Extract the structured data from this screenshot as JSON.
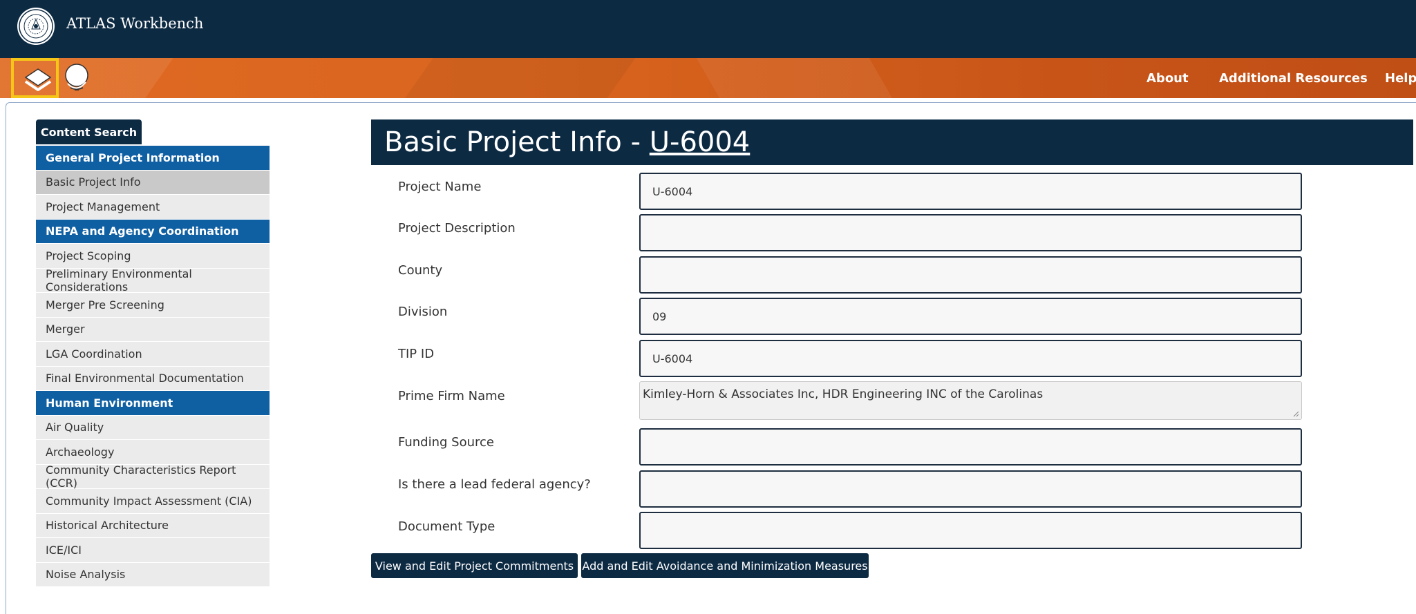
{
  "app": {
    "title": "ATLAS Workbench"
  },
  "toolbar": {
    "layers_icon": "layers-icon",
    "globe_icon": "globe-icon",
    "highlight_color": "#f5c518"
  },
  "topnav": [
    "About",
    "Additional Resources",
    "Help"
  ],
  "sidebar": {
    "search_button": "Content Search",
    "items": [
      {
        "label": "General Project Information",
        "type": "section"
      },
      {
        "label": "Basic Project Info",
        "type": "item",
        "active": true
      },
      {
        "label": "Project Management",
        "type": "item"
      },
      {
        "label": "NEPA and Agency Coordination",
        "type": "section"
      },
      {
        "label": "Project Scoping",
        "type": "item"
      },
      {
        "label": "Preliminary Environmental Considerations",
        "type": "item"
      },
      {
        "label": "Merger Pre Screening",
        "type": "item"
      },
      {
        "label": "Merger",
        "type": "item"
      },
      {
        "label": "LGA Coordination",
        "type": "item"
      },
      {
        "label": "Final Environmental Documentation",
        "type": "item"
      },
      {
        "label": "Human Environment",
        "type": "section"
      },
      {
        "label": "Air Quality",
        "type": "item"
      },
      {
        "label": "Archaeology",
        "type": "item"
      },
      {
        "label": "Community Characteristics Report (CCR)",
        "type": "item"
      },
      {
        "label": "Community Impact Assessment (CIA)",
        "type": "item"
      },
      {
        "label": "Historical Architecture",
        "type": "item"
      },
      {
        "label": "ICE/ICI",
        "type": "item"
      },
      {
        "label": "Noise Analysis",
        "type": "item"
      }
    ]
  },
  "main": {
    "title_prefix": "Basic Project Info - ",
    "project_code": "U-6004",
    "fields": [
      {
        "label": "Project Name",
        "value": "U-6004"
      },
      {
        "label": "Project Description",
        "value": ""
      },
      {
        "label": "County",
        "value": ""
      },
      {
        "label": "Division",
        "value": "09"
      },
      {
        "label": "TIP ID",
        "value": "U-6004"
      },
      {
        "label": "Prime Firm Name",
        "value": "Kimley-Horn & Associates Inc, HDR Engineering INC of the Carolinas"
      },
      {
        "label": "Funding Source",
        "value": ""
      },
      {
        "label": "Is there a lead federal agency?",
        "value": ""
      },
      {
        "label": "Document Type",
        "value": ""
      }
    ],
    "buttons": {
      "commitments": "View and Edit Project Commitments",
      "avoidance": "Add and Edit Avoidance and Minimization Measures"
    }
  },
  "colors": {
    "navy": "#0d2a43",
    "orange": "#d8641e",
    "section_blue": "#0f5fa3"
  }
}
